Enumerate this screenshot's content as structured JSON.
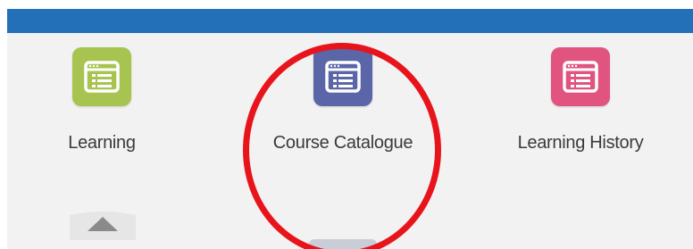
{
  "header": {
    "bar_color": "#2370b8"
  },
  "tiles": [
    {
      "label": "Learning",
      "icon": "list-window-icon",
      "color": "#a7c451"
    },
    {
      "label": "Course Catalogue",
      "icon": "list-window-icon",
      "color": "#5a66a8"
    },
    {
      "label": "Learning History",
      "icon": "list-window-icon",
      "color": "#e0547f"
    }
  ],
  "indicators": {
    "expand_caret": "caret-up-icon"
  },
  "annotation": {
    "shape": "circle",
    "color": "#e8141c",
    "target": "Course Catalogue"
  }
}
